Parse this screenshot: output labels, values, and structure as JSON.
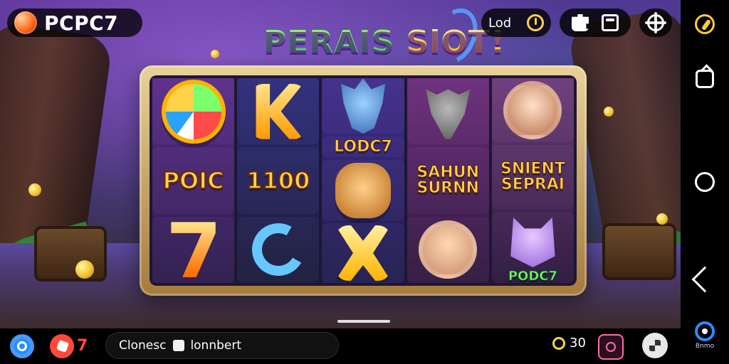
{
  "app": {
    "brand": "PCPC7",
    "title_left": "PERAIS",
    "title_right": "SlOT!"
  },
  "top_controls": {
    "lod_label": "Lod"
  },
  "reels": [
    [
      "sym-ball",
      "POIC",
      "sym-7"
    ],
    [
      "sym-k",
      "1100",
      "sym-c"
    ],
    [
      "sym-wolf",
      "LODC7",
      "sym-lion",
      "sym-x"
    ],
    [
      "sym-goat",
      "SAHUN\nSURNN",
      "sym-face"
    ],
    [
      "sym-face",
      "SNIENT\nSEPRAI",
      "sym-cat",
      "PODC7"
    ]
  ],
  "reel_texts": {
    "r1_mid": "POIC",
    "r2_mid": "1100",
    "r3_top": "LODC7",
    "r4_mid_1": "SAHUN",
    "r4_mid_2": "SURNN",
    "r5_mid_1": "SNIENT",
    "r5_mid_2": "SEPRAI",
    "r5_bot": "PODC7"
  },
  "bottom_bar": {
    "alert_count": "7",
    "message_text": "Clonesc",
    "message_right": "lonnbert",
    "balance": "30"
  },
  "system_bar": {
    "mini_label": "Bnmo"
  },
  "colors": {
    "accent_yellow": "#ffd24a",
    "accent_blue": "#2a8cff",
    "accent_red": "#ff4a3a",
    "accent_pink": "#ff6aa9"
  },
  "icons": {
    "brand": "brand-logo-icon",
    "lod": "power-icon",
    "tools_1": "puzzle-icon",
    "tools_2": "window-icon",
    "settings": "gear-icon",
    "sys_top": "compass-icon",
    "sys_share": "share-icon",
    "sys_home": "circle-icon",
    "sys_back": "back-icon",
    "sys_mini": "mini-icon",
    "chat": "chat-icon",
    "alert": "alert-icon",
    "balance": "coin-gear-icon",
    "hex": "hex-icon",
    "menu": "menu-icon"
  }
}
